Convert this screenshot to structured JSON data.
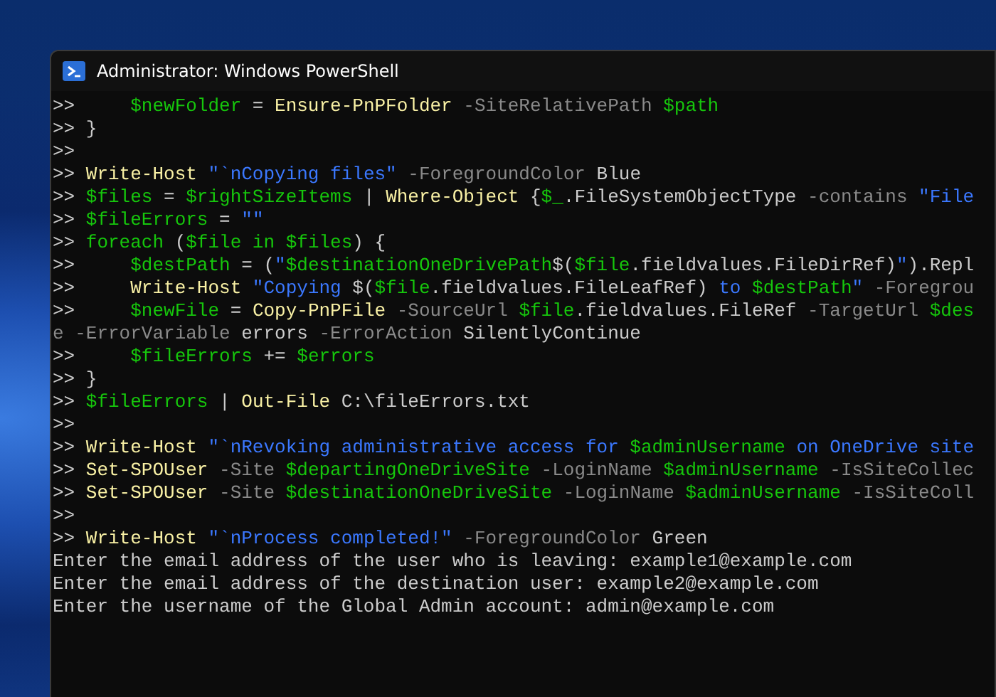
{
  "window": {
    "title": "Administrator: Windows PowerShell"
  },
  "console": {
    "lines": [
      [
        {
          "kind": "prompt",
          "text": ">>     "
        },
        {
          "kind": "var",
          "text": "$newFolder"
        },
        {
          "kind": "plain",
          "text": " = "
        },
        {
          "kind": "cmd",
          "text": "Ensure-PnPFolder"
        },
        {
          "kind": "param",
          "text": " -SiteRelativePath"
        },
        {
          "kind": "var",
          "text": " $path"
        }
      ],
      [
        {
          "kind": "prompt",
          "text": ">> "
        },
        {
          "kind": "plain",
          "text": "}"
        }
      ],
      [
        {
          "kind": "prompt",
          "text": ">>"
        }
      ],
      [
        {
          "kind": "prompt",
          "text": ">> "
        },
        {
          "kind": "cmd",
          "text": "Write-Host"
        },
        {
          "kind": "string",
          "text": " \"`nCopying files\""
        },
        {
          "kind": "param",
          "text": " -ForegroundColor"
        },
        {
          "kind": "plain",
          "text": " Blue"
        }
      ],
      [
        {
          "kind": "prompt",
          "text": ">> "
        },
        {
          "kind": "var",
          "text": "$files"
        },
        {
          "kind": "plain",
          "text": " = "
        },
        {
          "kind": "var",
          "text": "$rightSizeItems"
        },
        {
          "kind": "plain",
          "text": " | "
        },
        {
          "kind": "cmd",
          "text": "Where-Object"
        },
        {
          "kind": "plain",
          "text": " {"
        },
        {
          "kind": "var",
          "text": "$_"
        },
        {
          "kind": "plain",
          "text": ".FileSystemObjectType"
        },
        {
          "kind": "param",
          "text": " -contains"
        },
        {
          "kind": "string",
          "text": " \"File"
        }
      ],
      [
        {
          "kind": "prompt",
          "text": ">> "
        },
        {
          "kind": "var",
          "text": "$fileErrors"
        },
        {
          "kind": "plain",
          "text": " = "
        },
        {
          "kind": "string",
          "text": "\"\""
        }
      ],
      [
        {
          "kind": "prompt",
          "text": ">> "
        },
        {
          "kind": "var",
          "text": "foreach"
        },
        {
          "kind": "plain",
          "text": " ("
        },
        {
          "kind": "var",
          "text": "$file in $files"
        },
        {
          "kind": "plain",
          "text": ") {"
        }
      ],
      [
        {
          "kind": "prompt",
          "text": ">>     "
        },
        {
          "kind": "var",
          "text": "$destPath"
        },
        {
          "kind": "plain",
          "text": " = ("
        },
        {
          "kind": "string",
          "text": "\""
        },
        {
          "kind": "var",
          "text": "$destinationOneDrivePath"
        },
        {
          "kind": "plain",
          "text": "$("
        },
        {
          "kind": "var",
          "text": "$file"
        },
        {
          "kind": "plain",
          "text": ".fieldvalues.FileDirRef)"
        },
        {
          "kind": "string",
          "text": "\""
        },
        {
          "kind": "plain",
          "text": ").Repl"
        }
      ],
      [
        {
          "kind": "prompt",
          "text": ">>     "
        },
        {
          "kind": "cmd",
          "text": "Write-Host"
        },
        {
          "kind": "string",
          "text": " \"Copying "
        },
        {
          "kind": "plain",
          "text": "$("
        },
        {
          "kind": "var",
          "text": "$file"
        },
        {
          "kind": "plain",
          "text": ".fieldvalues.FileLeafRef)"
        },
        {
          "kind": "string",
          "text": " to "
        },
        {
          "kind": "var",
          "text": "$destPath"
        },
        {
          "kind": "string",
          "text": "\""
        },
        {
          "kind": "param",
          "text": " -Foregrou"
        }
      ],
      [
        {
          "kind": "prompt",
          "text": ">>     "
        },
        {
          "kind": "var",
          "text": "$newFile"
        },
        {
          "kind": "plain",
          "text": " = "
        },
        {
          "kind": "cmd",
          "text": "Copy-PnPFile"
        },
        {
          "kind": "param",
          "text": " -SourceUrl"
        },
        {
          "kind": "var",
          "text": " $file"
        },
        {
          "kind": "plain",
          "text": ".fieldvalues.FileRef"
        },
        {
          "kind": "param",
          "text": " -TargetUrl"
        },
        {
          "kind": "var",
          "text": " $des"
        }
      ],
      [
        {
          "kind": "param",
          "text": "e -ErrorVariable"
        },
        {
          "kind": "plain",
          "text": " errors"
        },
        {
          "kind": "param",
          "text": " -ErrorAction"
        },
        {
          "kind": "plain",
          "text": " SilentlyContinue"
        }
      ],
      [
        {
          "kind": "prompt",
          "text": ">>     "
        },
        {
          "kind": "var",
          "text": "$fileErrors"
        },
        {
          "kind": "plain",
          "text": " += "
        },
        {
          "kind": "var",
          "text": "$errors"
        }
      ],
      [
        {
          "kind": "prompt",
          "text": ">> "
        },
        {
          "kind": "plain",
          "text": "}"
        }
      ],
      [
        {
          "kind": "prompt",
          "text": ">> "
        },
        {
          "kind": "var",
          "text": "$fileErrors"
        },
        {
          "kind": "plain",
          "text": " | "
        },
        {
          "kind": "cmd",
          "text": "Out-File"
        },
        {
          "kind": "plain",
          "text": " C:\\fileErrors.txt"
        }
      ],
      [
        {
          "kind": "prompt",
          "text": ">>"
        }
      ],
      [
        {
          "kind": "prompt",
          "text": ">> "
        },
        {
          "kind": "cmd",
          "text": "Write-Host"
        },
        {
          "kind": "string",
          "text": " \"`nRevoking administrative access for "
        },
        {
          "kind": "var",
          "text": "$adminUsername"
        },
        {
          "kind": "string",
          "text": " on OneDrive site"
        }
      ],
      [
        {
          "kind": "prompt",
          "text": ">> "
        },
        {
          "kind": "cmd",
          "text": "Set-SPOUser"
        },
        {
          "kind": "param",
          "text": " -Site"
        },
        {
          "kind": "var",
          "text": " $departingOneDriveSite"
        },
        {
          "kind": "param",
          "text": " -LoginName"
        },
        {
          "kind": "var",
          "text": " $adminUsername"
        },
        {
          "kind": "param",
          "text": " -IsSiteCollec"
        }
      ],
      [
        {
          "kind": "prompt",
          "text": ">> "
        },
        {
          "kind": "cmd",
          "text": "Set-SPOUser"
        },
        {
          "kind": "param",
          "text": " -Site"
        },
        {
          "kind": "var",
          "text": " $destinationOneDriveSite"
        },
        {
          "kind": "param",
          "text": " -LoginName"
        },
        {
          "kind": "var",
          "text": " $adminUsername"
        },
        {
          "kind": "param",
          "text": " -IsSiteColl"
        }
      ],
      [
        {
          "kind": "prompt",
          "text": ">>"
        }
      ],
      [
        {
          "kind": "prompt",
          "text": ">> "
        },
        {
          "kind": "cmd",
          "text": "Write-Host"
        },
        {
          "kind": "string",
          "text": " \"`nProcess completed!\""
        },
        {
          "kind": "param",
          "text": " -ForegroundColor"
        },
        {
          "kind": "plain",
          "text": " Green"
        }
      ],
      [
        {
          "kind": "plain",
          "text": "Enter the email address of the user who is leaving: example1@example.com"
        }
      ],
      [
        {
          "kind": "plain",
          "text": "Enter the email address of the destination user: example2@example.com"
        }
      ],
      [
        {
          "kind": "plain",
          "text": "Enter the username of the Global Admin account: admin@example.com"
        }
      ]
    ]
  }
}
